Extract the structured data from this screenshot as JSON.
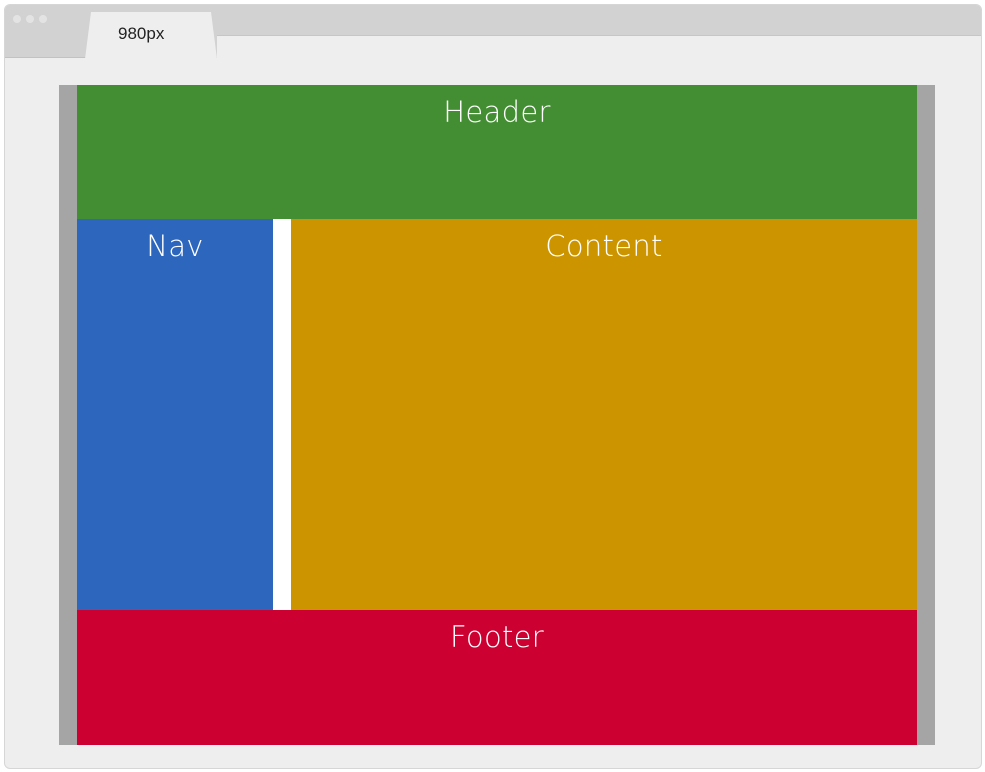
{
  "browser": {
    "tab_label": "980px"
  },
  "regions": {
    "header": {
      "label": "Header",
      "color": "#438e33"
    },
    "nav": {
      "label": "Nav",
      "color": "#2c66bd"
    },
    "content": {
      "label": "Content",
      "color": "#cc9500"
    },
    "footer": {
      "label": "Footer",
      "color": "#cd0032"
    }
  },
  "colors": {
    "frame": "#eeeeee",
    "titlebar": "#d2d2d2",
    "viewport_edge": "#a5a5a5",
    "gutter": "#ffffff"
  }
}
